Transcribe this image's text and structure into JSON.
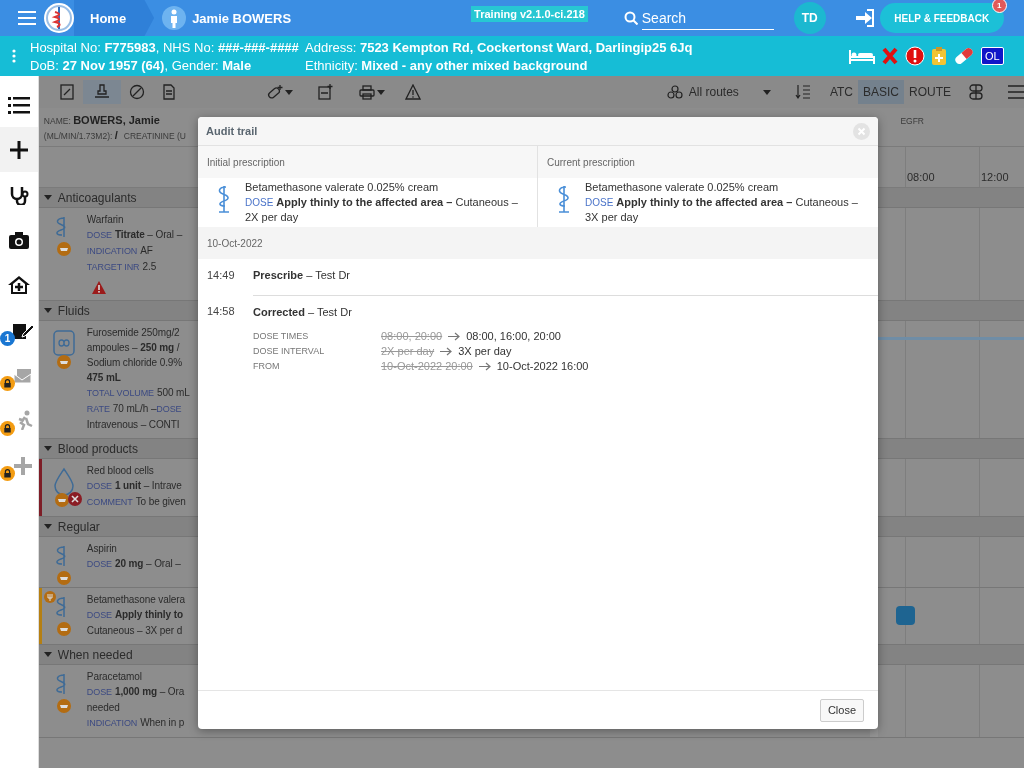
{
  "header": {
    "home_label": "Home",
    "patient_name": "Jamie BOWERS",
    "version": "Training v2.1.0-ci.218",
    "search_placeholder": "Search",
    "user_initials": "TD",
    "help_button": "HELP & FEEDBACK",
    "help_badge": "1"
  },
  "patient_bar": {
    "lines_left": [
      "Hospital No: **F775983**, NHS No: **###-###-####**",
      "DoB: **27 Nov 1957 (64)**, Gender: **Male**"
    ],
    "lines_right": [
      "Address: **7523 Kempton Rd, Cockertonst Ward, Darlingip25 6Jq**",
      "Ethnicity: **Mixed - any other mixed background**"
    ],
    "ol_badge": "OL"
  },
  "nav": [
    {
      "locked": false
    },
    {
      "locked": false
    },
    {
      "locked": false
    },
    {
      "locked": false
    },
    {
      "locked": false
    },
    {
      "locked": false,
      "badge": "1"
    },
    {
      "locked": true
    },
    {
      "locked": true
    },
    {
      "locked": true
    }
  ],
  "toolbar": {
    "tools": [
      {
        "selected": false
      },
      {
        "selected": true
      },
      {
        "selected": false
      },
      {
        "selected": false
      }
    ],
    "route_filter": "All routes",
    "views": [
      {
        "label": "ATC",
        "selected": false
      },
      {
        "label": "BASIC",
        "selected": true
      },
      {
        "label": "ROUTE",
        "selected": false
      }
    ]
  },
  "info_strip": {
    "line_1": [
      {
        "label": "NAME:",
        "value": "BOWERS, Jamie"
      }
    ],
    "line_1_right": [
      {
        "label": "EGFR"
      }
    ],
    "line_2": [
      {
        "label": "(ML/MIN/1.73M2):",
        "value": "/"
      },
      {
        "label": "CREATININE (U"
      }
    ]
  },
  "timeline": {
    "times": [
      "08:00",
      "12:00"
    ]
  },
  "sections": [
    {
      "title": "Anticoagulants",
      "expanded": true,
      "items": [
        {
          "kind": "medicine",
          "warning": true,
          "cancelled": false,
          "paused": false,
          "infusion": false,
          "dose_marker": false,
          "lines": [
            [
              {
                "text": "Warfarin"
              }
            ],
            [
              {
                "label": "DOSE",
                "text": "**Titrate** – Oral –"
              }
            ],
            [
              {
                "label": "INDICATION",
                "text": "AF"
              }
            ],
            [
              {
                "label": "TARGET INR",
                "text": "2.5"
              }
            ]
          ]
        }
      ]
    },
    {
      "title": "Fluids",
      "expanded": true,
      "items": [
        {
          "kind": "fluid",
          "warning": false,
          "cancelled": false,
          "paused": false,
          "infusion": true,
          "dose_marker": false,
          "lines": [
            [
              {
                "text": "Furosemide 250mg/2"
              }
            ],
            [
              {
                "text": "ampoules – **250 mg** /"
              }
            ],
            [
              {
                "text": "Sodium chloride 0.9%"
              }
            ],
            [
              {
                "text": "**475 mL**"
              }
            ],
            [
              {
                "label": "TOTAL VOLUME",
                "text": "500 mL"
              }
            ],
            [
              {
                "label": "RATE",
                "text": "70 mL/h –"
              },
              {
                "label": "DOSE"
              }
            ],
            [
              {
                "text": "Intravenous – CONTI"
              }
            ]
          ]
        }
      ]
    },
    {
      "title": "Blood products",
      "expanded": true,
      "items": [
        {
          "kind": "blood",
          "warning": false,
          "cancelled": true,
          "paused": false,
          "infusion": false,
          "dose_marker": false,
          "color": "#7d1d26",
          "lines": [
            [
              {
                "text": "Red blood cells"
              }
            ],
            [
              {
                "label": "DOSE",
                "text": "**1 unit** – Intrave"
              }
            ],
            [
              {
                "label": "COMMENT",
                "text": "To be given"
              }
            ]
          ]
        }
      ]
    },
    {
      "title": "Regular",
      "expanded": true,
      "items": [
        {
          "kind": "medicine",
          "warning": false,
          "cancelled": false,
          "paused": false,
          "infusion": false,
          "dose_marker": false,
          "lines": [
            [
              {
                "text": "Aspirin"
              }
            ],
            [
              {
                "label": "DOSE",
                "text": "**20 mg** – Oral –"
              }
            ]
          ]
        },
        {
          "kind": "medicine",
          "warning": false,
          "cancelled": false,
          "paused": true,
          "infusion": false,
          "dose_marker": true,
          "color": "#b57f12",
          "lines": [
            [
              {
                "text": "Betamethasone valera"
              }
            ],
            [
              {
                "label": "DOSE",
                "text": "**Apply thinly to**"
              }
            ],
            [
              {
                "text": "Cutaneous – 3X per d"
              }
            ]
          ]
        }
      ]
    },
    {
      "title": "When needed",
      "expanded": true,
      "items": [
        {
          "kind": "medicine",
          "warning": false,
          "cancelled": false,
          "paused": false,
          "infusion": false,
          "dose_marker": false,
          "lines": [
            [
              {
                "text": "Paracetamol"
              }
            ],
            [
              {
                "label": "DOSE",
                "text": "**1,000 mg** – Ora"
              }
            ],
            [
              {
                "text": "needed"
              }
            ],
            [
              {
                "label": "INDICATION",
                "text": "When in p"
              }
            ]
          ]
        }
      ]
    }
  ],
  "audit_dialog": {
    "title": "Audit trail",
    "columns": [
      {
        "heading": "Initial prescription",
        "drug": "Betamethasone valerate 0.025% cream",
        "dose_label": "DOSE",
        "dose": "**Apply thinly to the affected area –** Cutaneous – 2X per day"
      },
      {
        "heading": "Current prescription",
        "drug": "Betamethasone valerate 0.025% cream",
        "dose_label": "DOSE",
        "dose": "**Apply thinly to the affected area –** Cutaneous – 3X per day"
      }
    ],
    "date": "10-Oct-2022",
    "events": [
      {
        "time": "14:49",
        "title": "**Prescribe**  –  Test Dr"
      },
      {
        "time": "14:58",
        "title": "**Corrected**  –  Test Dr",
        "changes": [
          {
            "field": "DOSE TIMES",
            "old": "08:00, 20:00",
            "new": "08:00, 16:00, 20:00"
          },
          {
            "field": "DOSE INTERVAL",
            "old": "2X per day",
            "new": "3X per day"
          },
          {
            "field": "FROM",
            "old": "10-Oct-2022 20:00",
            "new": "10-Oct-2022 16:00"
          }
        ]
      }
    ],
    "close_button": "Close"
  }
}
